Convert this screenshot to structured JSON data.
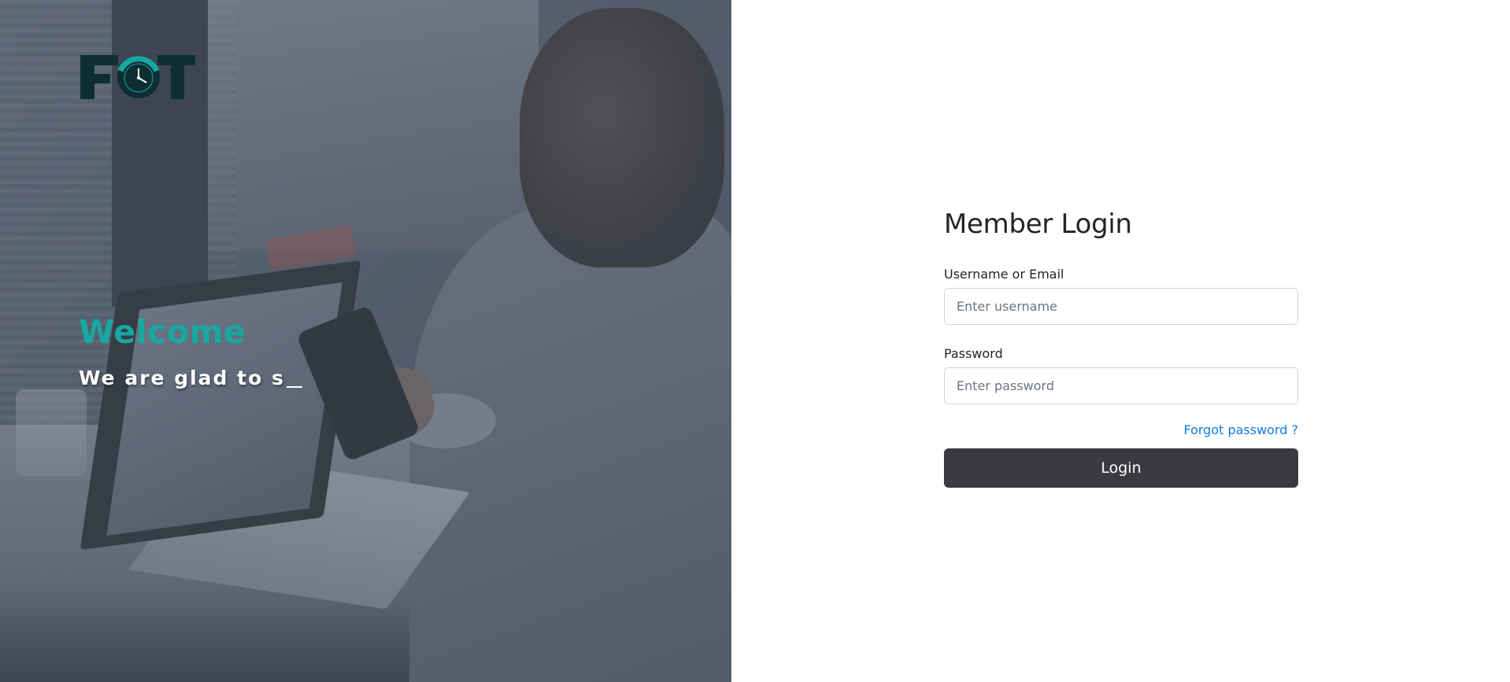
{
  "hero": {
    "welcome": "Welcome",
    "tagline": "We are glad to s",
    "logo_text": "FOT",
    "background_image": "man-with-phone-and-laptop-photo"
  },
  "login": {
    "title": "Member Login",
    "username_label": "Username or Email",
    "username_placeholder": "Enter username",
    "password_label": "Password",
    "password_placeholder": "Enter password",
    "forgot_label": "Forgot password ?",
    "submit_label": "Login"
  },
  "colors": {
    "accent": "#17a9a1",
    "logo_dark": "#0f2e33",
    "link": "#0d7ce6",
    "button": "#3a3b3f"
  }
}
